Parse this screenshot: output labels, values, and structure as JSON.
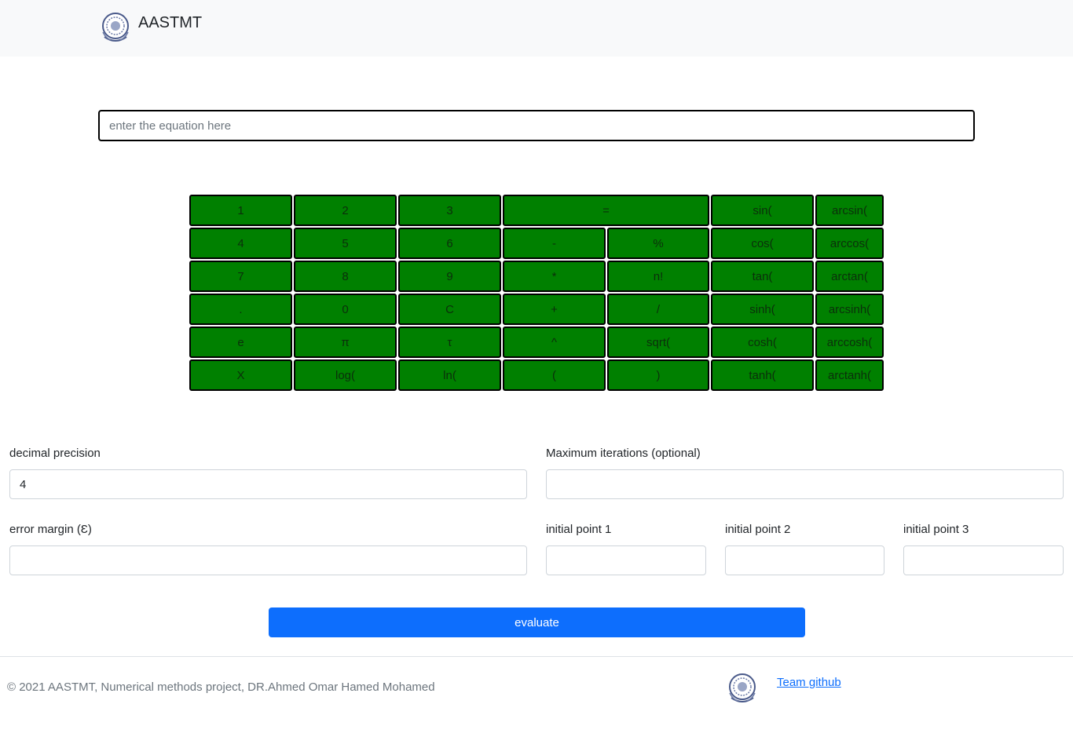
{
  "navbar": {
    "brand": "AASTMT",
    "logo": "aastmt-logo-icon"
  },
  "equation": {
    "placeholder": "enter the equation here",
    "value": ""
  },
  "keypad": [
    [
      "1",
      "2",
      "3",
      "=",
      "sin(",
      "arcsin("
    ],
    [
      "4",
      "5",
      "6",
      "-",
      "%",
      "cos(",
      "arccos("
    ],
    [
      "7",
      "8",
      "9",
      "*",
      "n!",
      "tan(",
      "arctan("
    ],
    [
      ".",
      "0",
      "C",
      "+",
      "/",
      "sinh(",
      "arcsinh("
    ],
    [
      "e",
      "π",
      "τ",
      "^",
      "sqrt(",
      "cosh(",
      "arccosh("
    ],
    [
      "X",
      "log(",
      "ln(",
      "(",
      ")",
      "tanh(",
      "arctanh("
    ]
  ],
  "form": {
    "decimal_precision": {
      "label": "decimal precision",
      "value": "4"
    },
    "max_iterations": {
      "label": "Maximum iterations (optional)",
      "value": ""
    },
    "error_margin": {
      "label": "error margin (Ɛ)",
      "value": ""
    },
    "initial_point_1": {
      "label": "initial point 1",
      "value": ""
    },
    "initial_point_2": {
      "label": "initial point 2",
      "value": ""
    },
    "initial_point_3": {
      "label": "initial point 3",
      "value": ""
    },
    "evaluate_label": "evaluate"
  },
  "footer": {
    "copyright": "© 2021 AASTMT, Numerical methods project, DR.Ahmed Omar Hamed Mohamed",
    "link": "Team github",
    "logo": "aastmt-logo-icon"
  },
  "colors": {
    "key_bg": "#008000",
    "primary": "#0d6efd",
    "navbar_bg": "#f8f9fa"
  }
}
